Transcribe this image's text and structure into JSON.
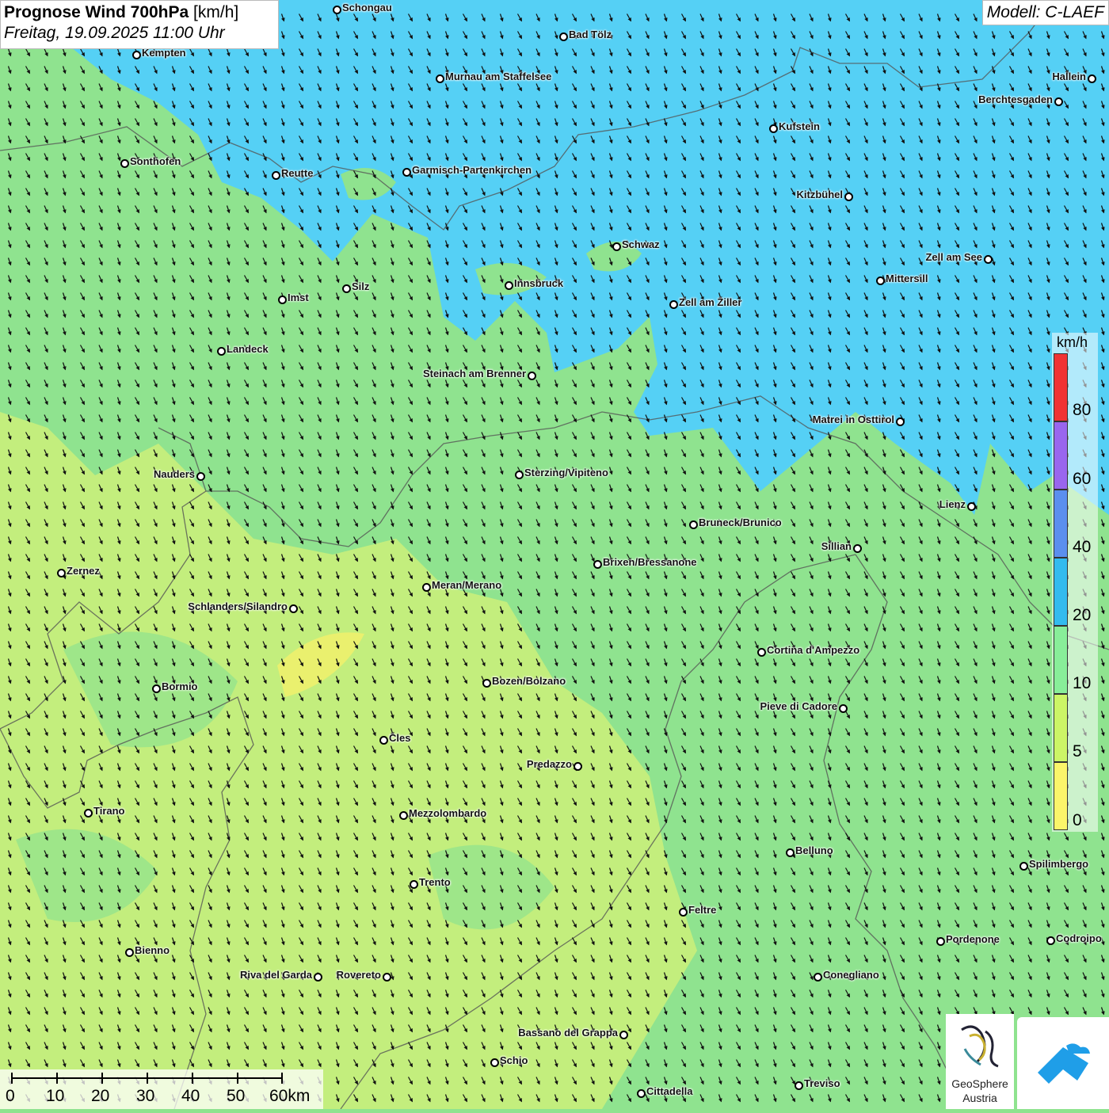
{
  "header": {
    "title_bold": "Prognose Wind 700hPa",
    "title_unit": "[km/h]",
    "datetime": "Freitag, 19.09.2025 11:00 Uhr",
    "model": "Modell: C-LAEF"
  },
  "legend": {
    "unit": "km/h",
    "ticks": [
      "80",
      "60",
      "40",
      "20",
      "10",
      "5",
      "0"
    ],
    "colors": [
      "#f03333",
      "#9966ee",
      "#5b8fee",
      "#33bbee",
      "#88ee99",
      "#ccf566",
      "#fbf56a"
    ]
  },
  "scale": {
    "labels": [
      "0",
      "10",
      "20",
      "30",
      "40",
      "50",
      "60km"
    ]
  },
  "logos": {
    "geosphere_line1": "GeoSphere",
    "geosphere_line2": "Austria"
  },
  "cities": [
    {
      "name": "Schongau"
    },
    {
      "name": "Bad Tölz"
    },
    {
      "name": "Kempten"
    },
    {
      "name": "Murnau am Staffelsee"
    },
    {
      "name": "Hallein"
    },
    {
      "name": "Berchtesgaden"
    },
    {
      "name": "Kufstein"
    },
    {
      "name": "Sonthofen"
    },
    {
      "name": "Reutte"
    },
    {
      "name": "Garmisch-Partenkirchen"
    },
    {
      "name": "Kitzbühel"
    },
    {
      "name": "Schwaz"
    },
    {
      "name": "Zell am See"
    },
    {
      "name": "Mittersill"
    },
    {
      "name": "Innsbruck"
    },
    {
      "name": "Silz"
    },
    {
      "name": "Imst"
    },
    {
      "name": "Zell am Ziller"
    },
    {
      "name": "Landeck"
    },
    {
      "name": "Steinach am Brenner"
    },
    {
      "name": "Matrei in Osttirol"
    },
    {
      "name": "Nauders"
    },
    {
      "name": "Sterzing/Vipiteno"
    },
    {
      "name": "Lienz"
    },
    {
      "name": "Bruneck/Brunico"
    },
    {
      "name": "Sillian"
    },
    {
      "name": "Brixen/Bressanone"
    },
    {
      "name": "Zernez"
    },
    {
      "name": "Meran/Merano"
    },
    {
      "name": "Schlanders/Silandro"
    },
    {
      "name": "Cortina d'Ampezzo"
    },
    {
      "name": "Bozen/Bolzano"
    },
    {
      "name": "Bormio"
    },
    {
      "name": "Pieve di Cadore"
    },
    {
      "name": "Cles"
    },
    {
      "name": "Predazzo"
    },
    {
      "name": "Tirano"
    },
    {
      "name": "Mezzolombardo"
    },
    {
      "name": "Belluno"
    },
    {
      "name": "Spilimbergo"
    },
    {
      "name": "Trento"
    },
    {
      "name": "Feltre"
    },
    {
      "name": "Pordenone"
    },
    {
      "name": "Codroipo"
    },
    {
      "name": "Bienno"
    },
    {
      "name": "Riva del Garda"
    },
    {
      "name": "Rovereto"
    },
    {
      "name": "Conegliano"
    },
    {
      "name": "Bassano del Grappa"
    },
    {
      "name": "Schio"
    },
    {
      "name": "Treviso"
    },
    {
      "name": "Cittadella"
    }
  ]
}
